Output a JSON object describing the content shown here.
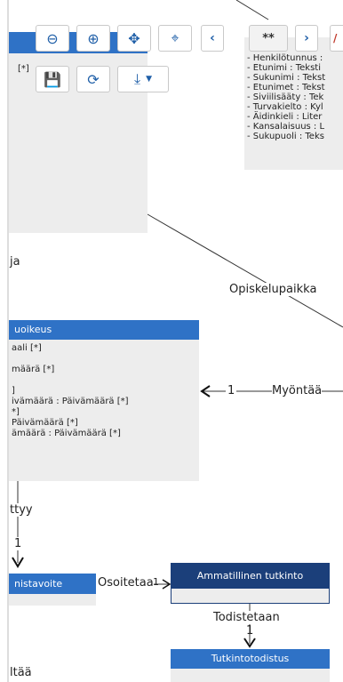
{
  "toolbar": {
    "row1": [
      {
        "name": "zoom-out-button",
        "icon": "zoom-out-icon",
        "glyph": "⊖"
      },
      {
        "name": "zoom-in-button",
        "icon": "zoom-in-icon",
        "glyph": "⊕"
      },
      {
        "name": "pan-button",
        "icon": "move-icon",
        "glyph": "✥"
      },
      {
        "name": "center-button",
        "icon": "crosshair-icon",
        "glyph": "⌖"
      },
      {
        "name": "previous-button",
        "icon": "chevron-left-icon",
        "glyph": "‹"
      },
      {
        "name": "page-indicator-button",
        "label": "**"
      },
      {
        "name": "next-button",
        "icon": "chevron-right-icon",
        "glyph": "›"
      }
    ],
    "row2": [
      {
        "name": "save-button",
        "icon": "save-icon",
        "glyph": "💾"
      },
      {
        "name": "refresh-button",
        "icon": "refresh-icon",
        "glyph": "⟳"
      },
      {
        "name": "download-dropdown-button",
        "icon": "download-icon",
        "glyph": "⤓"
      }
    ]
  },
  "person_entity": {
    "attributes": [
      "- Henkilötunnus :",
      "- Etunimi : Teksti",
      "- Sukunimi : Tekst",
      "- Etunimet : Tekst",
      "- Siviilisääty : Tek",
      "- Turvakielto : Kyl",
      "- Äidinkieli : Liter",
      "- Kansalaisuus : L",
      "- Sukupuoli : Teks"
    ]
  },
  "left_top_entity": {
    "marker": "[*]"
  },
  "labels": {
    "ja": "ja",
    "opiskelupaikka": "Opiskelupaikka",
    "myontaa": "Myöntää",
    "myontaa_mult": "1",
    "ttyy": "ttyy",
    "ttyy_mult": "1",
    "osoitetaan": "Osoitetaa",
    "osoitetaan_mult": "1",
    "todistetaan": "Todistetaan",
    "todistetaan_mult": "1",
    "ltaa": "ltää"
  },
  "oikeus_entity": {
    "title": "uoikeus",
    "attributes": [
      "aali [*]",
      "",
      "määrä [*]",
      "",
      "]",
      "ivämäärä : Päivämäärä [*]",
      "*]",
      "Päivämäärä [*]",
      "ämäärä : Päivämäärä [*]"
    ]
  },
  "tavoite_entity": {
    "title": "nistavoite"
  },
  "ammatillinen_entity": {
    "title": "Ammatillinen tutkinto"
  },
  "tutkintotodistus_entity": {
    "title": "Tutkintotodistus"
  }
}
